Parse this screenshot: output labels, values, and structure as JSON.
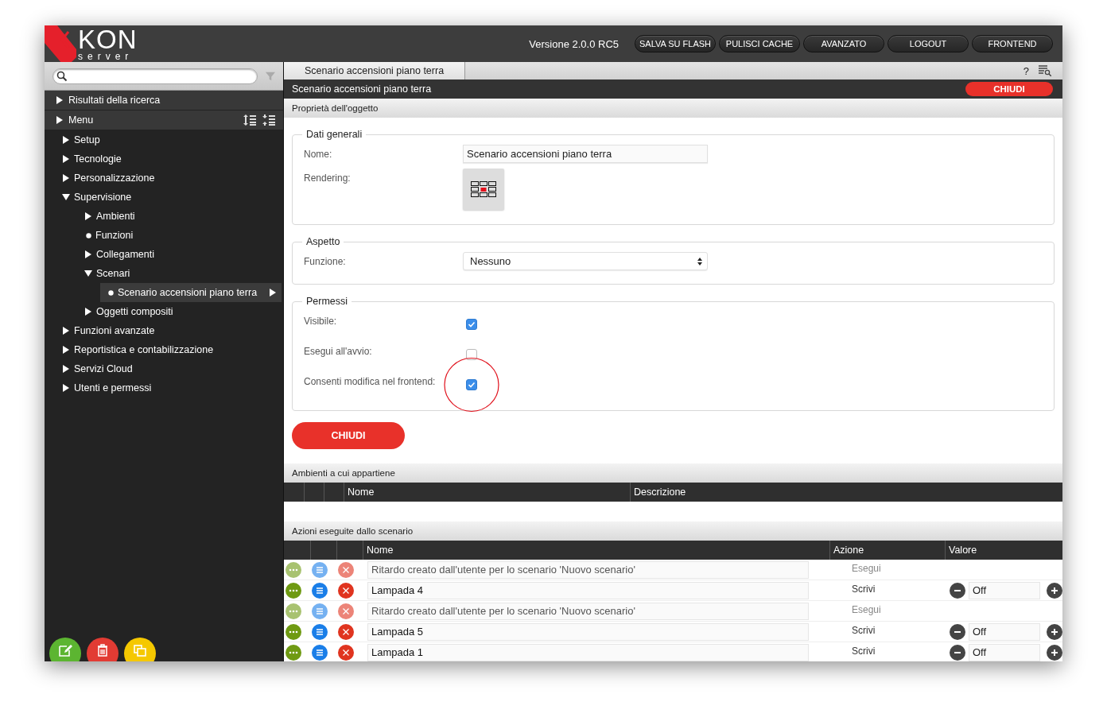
{
  "header": {
    "logo_mark": "KON",
    "logo_sub": "server",
    "version": "Versione 2.0.0 RC5",
    "buttons": [
      "SALVA SU FLASH",
      "PULISCI CACHE",
      "AVANZATO",
      "LOGOUT",
      "FRONTEND"
    ]
  },
  "sidebar": {
    "sections": [
      {
        "label": "Risultati della ricerca",
        "expanded": false
      },
      {
        "label": "Menu",
        "expanded": false
      }
    ],
    "tree": [
      {
        "label": "Setup",
        "kind": "branch",
        "expanded": false,
        "selected": false
      },
      {
        "label": "Tecnologie",
        "kind": "branch",
        "expanded": false,
        "selected": false
      },
      {
        "label": "Personalizzazione",
        "kind": "branch",
        "expanded": false,
        "selected": false
      },
      {
        "label": "Supervisione",
        "kind": "branch",
        "expanded": true,
        "selected": false,
        "children": [
          {
            "label": "Ambienti",
            "kind": "branch",
            "expanded": false,
            "selected": false
          },
          {
            "label": "Funzioni",
            "kind": "leaf",
            "selected": false
          },
          {
            "label": "Collegamenti",
            "kind": "branch",
            "expanded": false,
            "selected": false
          },
          {
            "label": "Scenari",
            "kind": "branch",
            "expanded": true,
            "selected": false,
            "children": [
              {
                "label": "Scenario accensioni piano terra",
                "kind": "leaf",
                "selected": true
              }
            ]
          },
          {
            "label": "Oggetti compositi",
            "kind": "branch",
            "expanded": false,
            "selected": false
          }
        ]
      },
      {
        "label": "Funzioni avanzate",
        "kind": "branch",
        "expanded": false,
        "selected": false
      },
      {
        "label": "Reportistica e contabilizzazione",
        "kind": "branch",
        "expanded": false,
        "selected": false
      },
      {
        "label": "Servizi Cloud",
        "kind": "branch",
        "expanded": false,
        "selected": false
      },
      {
        "label": "Utenti e permessi",
        "kind": "branch",
        "expanded": false,
        "selected": false
      }
    ],
    "buttons": [
      {
        "kind": "edit"
      },
      {
        "kind": "delete"
      },
      {
        "kind": "copy"
      }
    ]
  },
  "tabs": [
    {
      "label": "Scenario accensioni piano terra",
      "selected": true
    }
  ],
  "tab_bar_help": "?",
  "panel": {
    "title": "Scenario accensioni piano terra",
    "close_button": "CHIUDI",
    "section_title": "Proprietà dell'oggetto",
    "groups": [
      {
        "legend": "Dati generali",
        "fields": [
          {
            "label": "Nome:",
            "kind": "text",
            "value": "Scenario accensioni piano terra"
          },
          {
            "label": "Rendering:",
            "kind": "icon"
          }
        ]
      },
      {
        "legend": "Aspetto",
        "fields": [
          {
            "label": "Funzione:",
            "kind": "select",
            "value": "Nessuno"
          }
        ]
      },
      {
        "legend": "Permessi",
        "fields": [
          {
            "label": "Visibile:",
            "kind": "checkbox",
            "checked": true,
            "highlighted": false
          },
          {
            "label": "Esegui all'avvio:",
            "kind": "checkbox",
            "checked": false,
            "highlighted": false
          },
          {
            "label": "Consenti modifica nel frontend:",
            "kind": "checkbox",
            "checked": true,
            "highlighted": true
          }
        ]
      }
    ],
    "footer_button": "CHIUDI"
  },
  "environments": {
    "title": "Ambienti a cui appartiene",
    "columns": [
      "Nome",
      "Descrizione"
    ]
  },
  "actions": {
    "title": "Azioni eseguite dallo scenario",
    "columns": [
      "Nome",
      "Azione",
      "Valore"
    ],
    "rows": [
      {
        "name": "Ritardo creato dall'utente per lo scenario 'Nuovo scenario'",
        "action": "Esegui",
        "disabled": true
      },
      {
        "name": "Lampada 4",
        "action": "Scrivi",
        "disabled": false,
        "value": "Off"
      },
      {
        "name": "Ritardo creato dall'utente per lo scenario 'Nuovo scenario'",
        "action": "Esegui",
        "disabled": true
      },
      {
        "name": "Lampada 5",
        "action": "Scrivi",
        "disabled": false,
        "value": "Off"
      },
      {
        "name": "Lampada 1",
        "action": "Scrivi",
        "disabled": false,
        "value": "Off"
      }
    ]
  }
}
